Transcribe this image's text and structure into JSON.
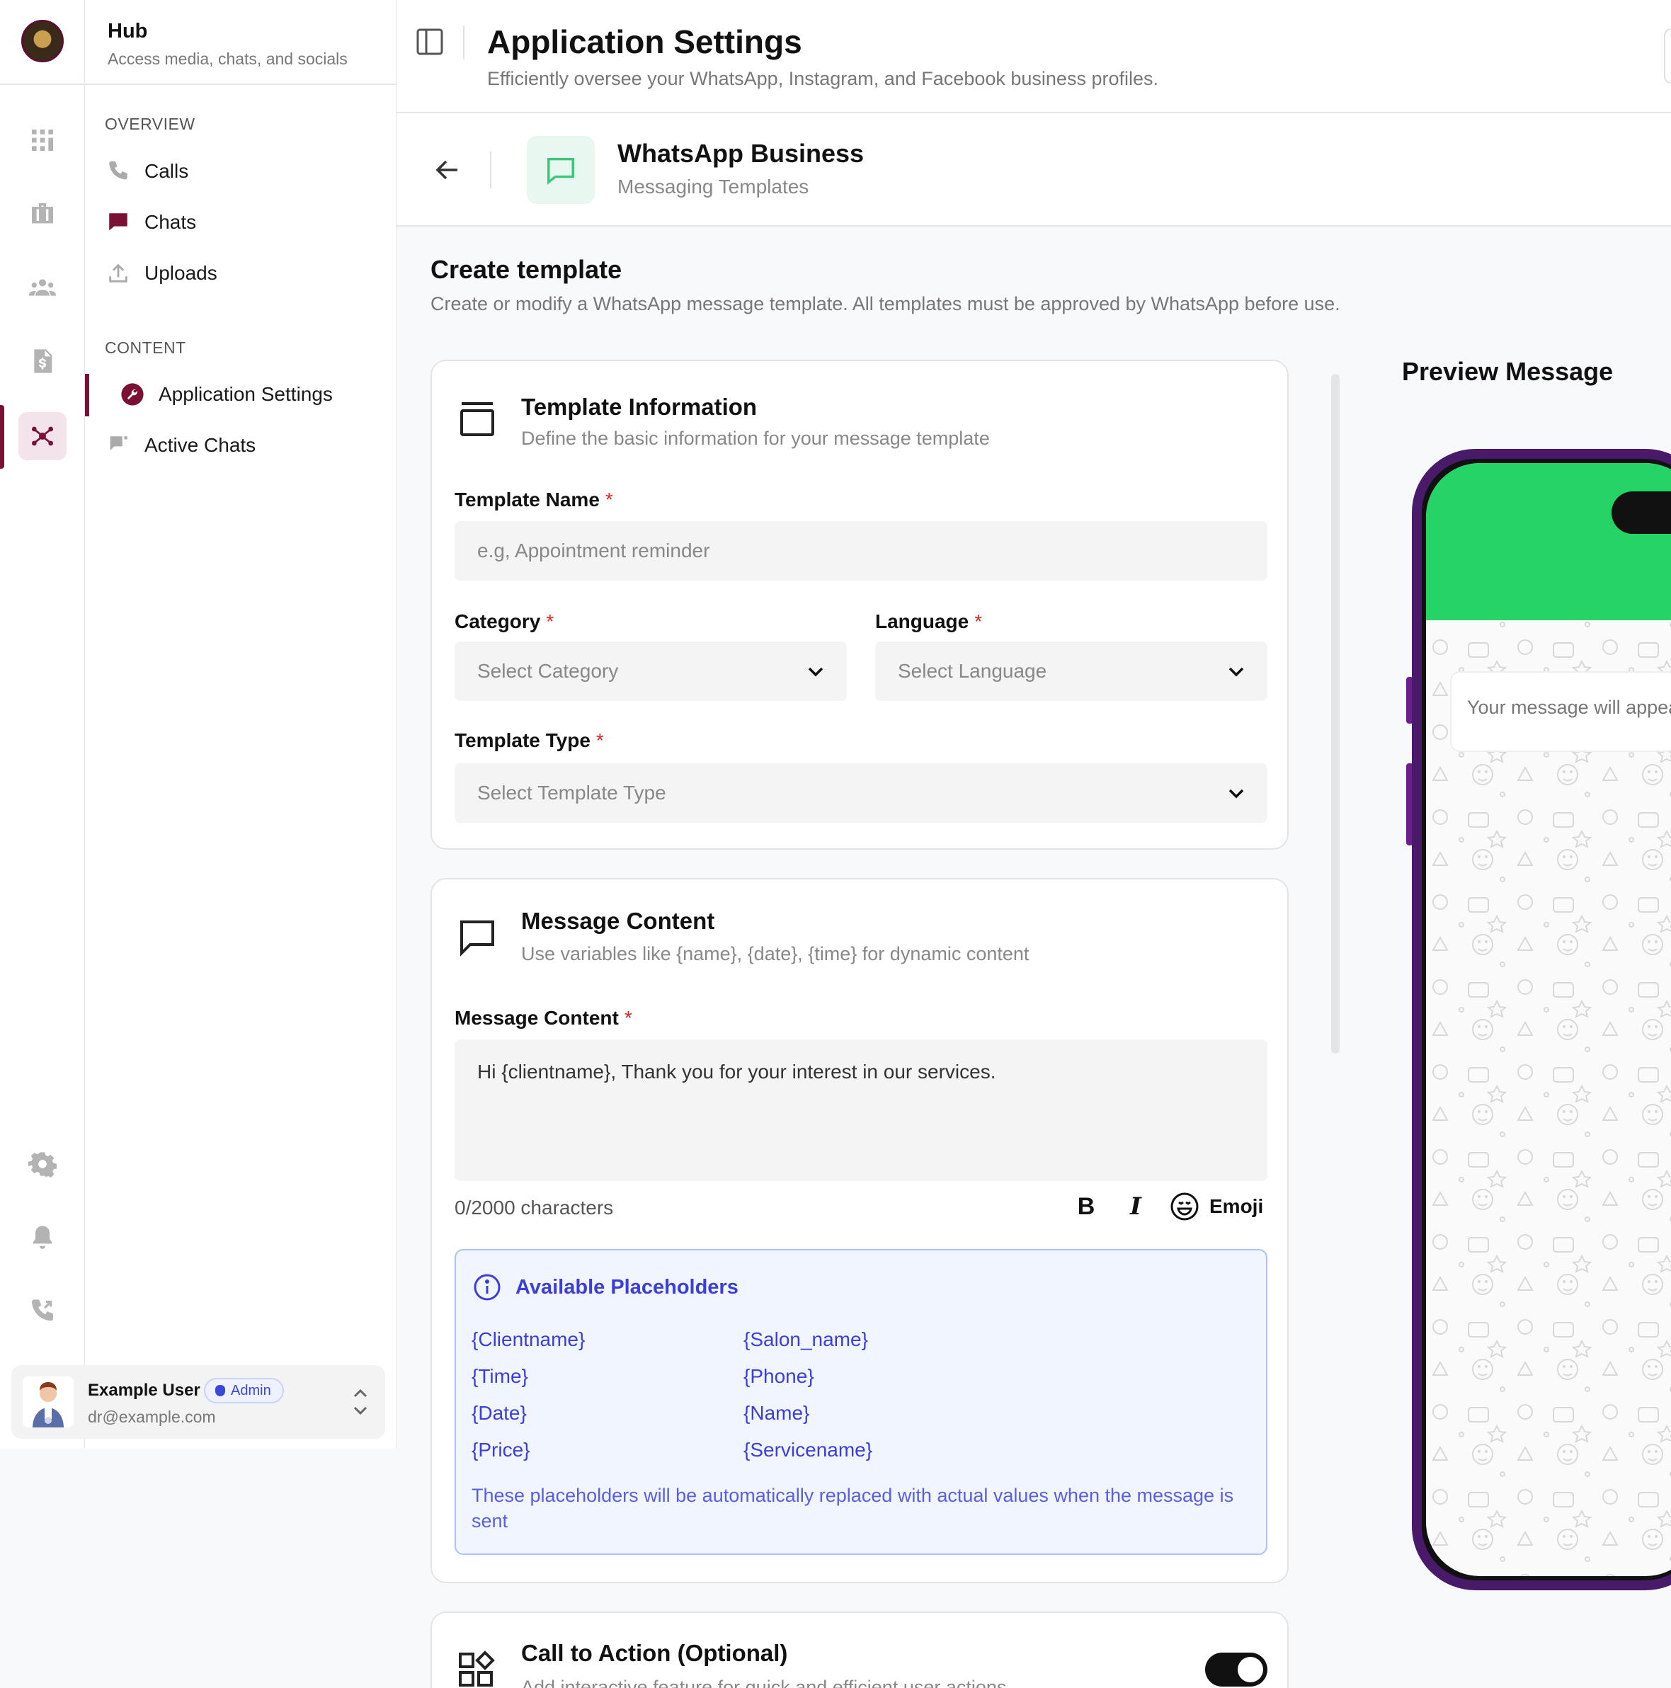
{
  "app": {
    "title": "Hub",
    "subtitle": "Access media, chats, and socials"
  },
  "rail": {
    "icons": [
      "grid-icon",
      "briefcase-icon",
      "people-icon",
      "invoice-icon",
      "network-icon",
      "settings-gear-icon",
      "bell-icon",
      "phone-forward-icon"
    ],
    "active": "network-icon"
  },
  "sidebar": {
    "overview_label": "OVERVIEW",
    "overview_items": [
      {
        "label": "Calls",
        "icon": "phone-icon"
      },
      {
        "label": "Chats",
        "icon": "chat-icon"
      },
      {
        "label": "Uploads",
        "icon": "upload-icon"
      }
    ],
    "content_label": "CONTENT",
    "content_items": [
      {
        "label": "Application Settings",
        "icon": "wrench-icon",
        "active": true
      },
      {
        "label": "Active Chats",
        "icon": "flag-chat-icon"
      }
    ]
  },
  "user": {
    "name": "Example User",
    "badge": "Admin",
    "email": "dr@example.com"
  },
  "header": {
    "title": "Application Settings",
    "subtitle": "Efficiently oversee your WhatsApp, Instagram, and Facebook business profiles."
  },
  "subheader": {
    "title": "WhatsApp Business",
    "subtitle": "Messaging Templates"
  },
  "content": {
    "title": "Create template",
    "subtitle": "Create or modify a WhatsApp message template. All templates must be approved by WhatsApp before use."
  },
  "template_info": {
    "title": "Template Information",
    "subtitle": "Define the basic information for your message template",
    "name_label": "Template Name",
    "name_placeholder": "e.g, Appointment reminder",
    "category_label": "Category",
    "category_value": "Select Category",
    "language_label": "Language",
    "language_value": "Select Language",
    "type_label": "Template Type",
    "type_value": "Select Template Type",
    "required_mark": "*"
  },
  "message_content": {
    "title": "Message Content",
    "subtitle": "Use variables like {name}, {date}, {time} for dynamic content",
    "label": "Message Content",
    "value": "Hi {clientname}, Thank you for your interest in our services.",
    "counter": "0/2000 characters",
    "bold": "B",
    "italic": "I",
    "emoji_label": "Emoji"
  },
  "placeholders": {
    "title": "Available Placeholders",
    "left": [
      "{Clientname}",
      "{Time}",
      "{Date}",
      "{Price}"
    ],
    "right": [
      "{Salon_name}",
      "{Phone}",
      "{Name}",
      "{Servicename}"
    ],
    "note": "These placeholders will be automatically replaced with actual values when the message is sent"
  },
  "cta": {
    "title": "Call to Action (Optional)",
    "subtitle": "Add interactive feature for quick and efficient user actions",
    "enabled": true
  },
  "preview": {
    "title": "Preview Message",
    "bubble_text": "Your message will appear here"
  },
  "colors": {
    "brand": "#7a1034",
    "whatsapp_green": "#25d366",
    "placeholder_blue": "#3b3fd8",
    "phone_frame": "#4a1a6a"
  }
}
